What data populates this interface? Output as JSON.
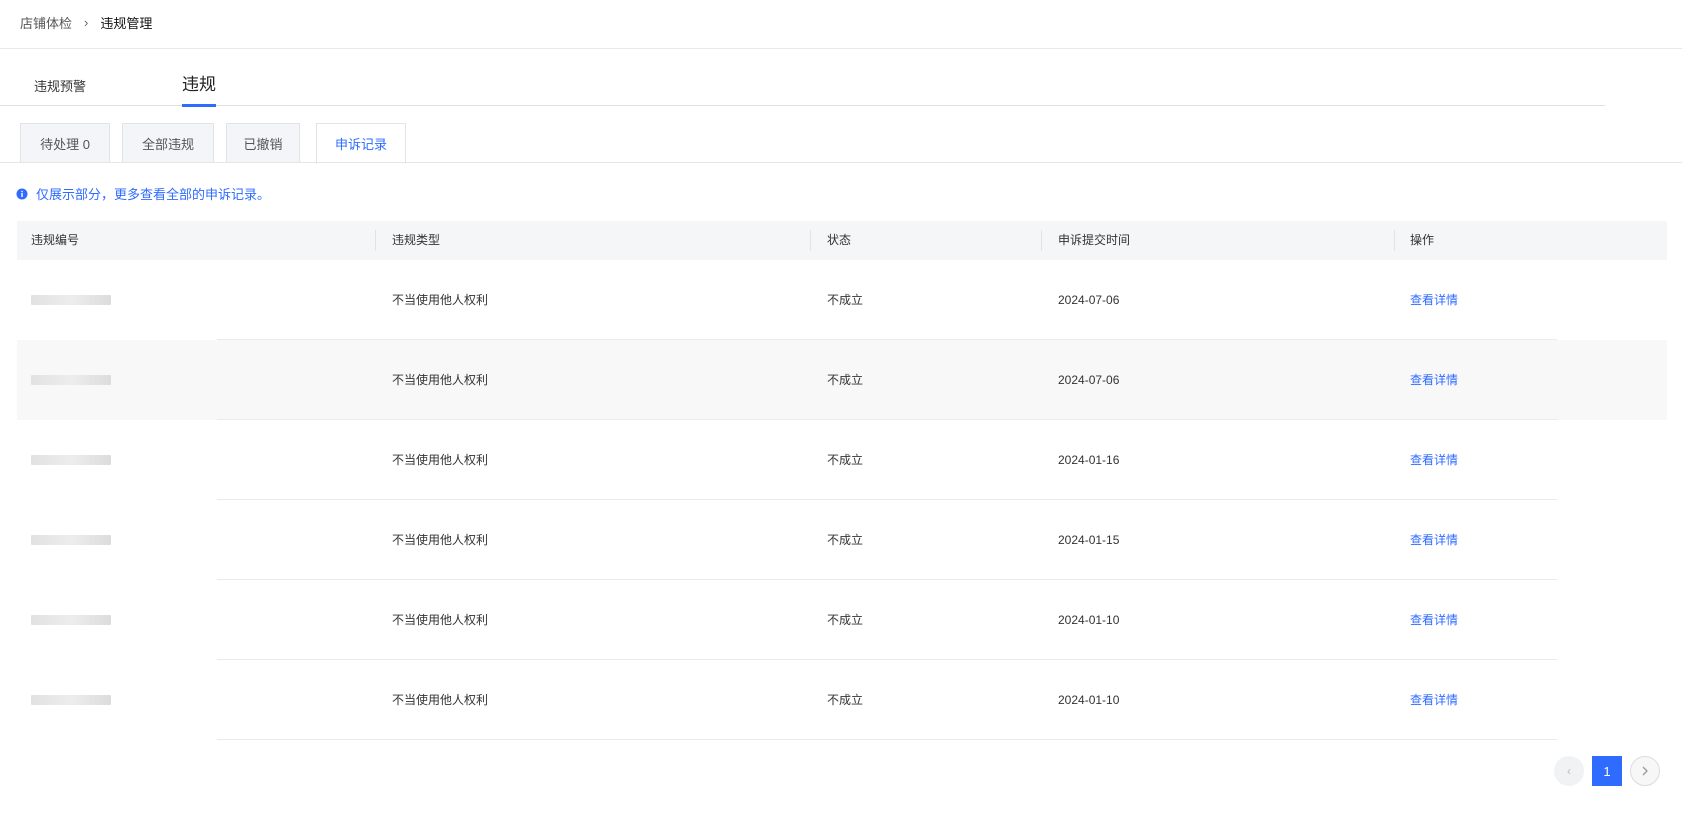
{
  "breadcrumb": {
    "parent": "店铺体检",
    "separator": "›",
    "current": "违规管理"
  },
  "main_tabs": [
    {
      "label": "违规预警"
    },
    {
      "label": "违规"
    }
  ],
  "sub_tabs": [
    {
      "label": "待处理 0"
    },
    {
      "label": "全部违规"
    },
    {
      "label": "已撤销"
    },
    {
      "label": "申诉记录"
    }
  ],
  "notice": {
    "icon": "info-icon",
    "text": "仅展示部分，更多查看全部的申诉记录。"
  },
  "table": {
    "headers": [
      "违规编号",
      "违规类型",
      "状态",
      "申诉提交时间",
      "操作"
    ],
    "rows": [
      {
        "type": "不当使用他人权利",
        "status": "不成立",
        "date": "2024-07-06",
        "action": "查看详情"
      },
      {
        "type": "不当使用他人权利",
        "status": "不成立",
        "date": "2024-07-06",
        "action": "查看详情"
      },
      {
        "type": "不当使用他人权利",
        "status": "不成立",
        "date": "2024-01-16",
        "action": "查看详情"
      },
      {
        "type": "不当使用他人权利",
        "status": "不成立",
        "date": "2024-01-15",
        "action": "查看详情"
      },
      {
        "type": "不当使用他人权利",
        "status": "不成立",
        "date": "2024-01-10",
        "action": "查看详情"
      },
      {
        "type": "不当使用他人权利",
        "status": "不成立",
        "date": "2024-01-10",
        "action": "查看详情"
      }
    ]
  },
  "pagination": {
    "prev": "‹",
    "current_page": "1",
    "next": "›"
  },
  "colors": {
    "accent": "#2f6bff",
    "header_bg": "#f5f6f8",
    "tab_bg": "#f4f5f8"
  }
}
